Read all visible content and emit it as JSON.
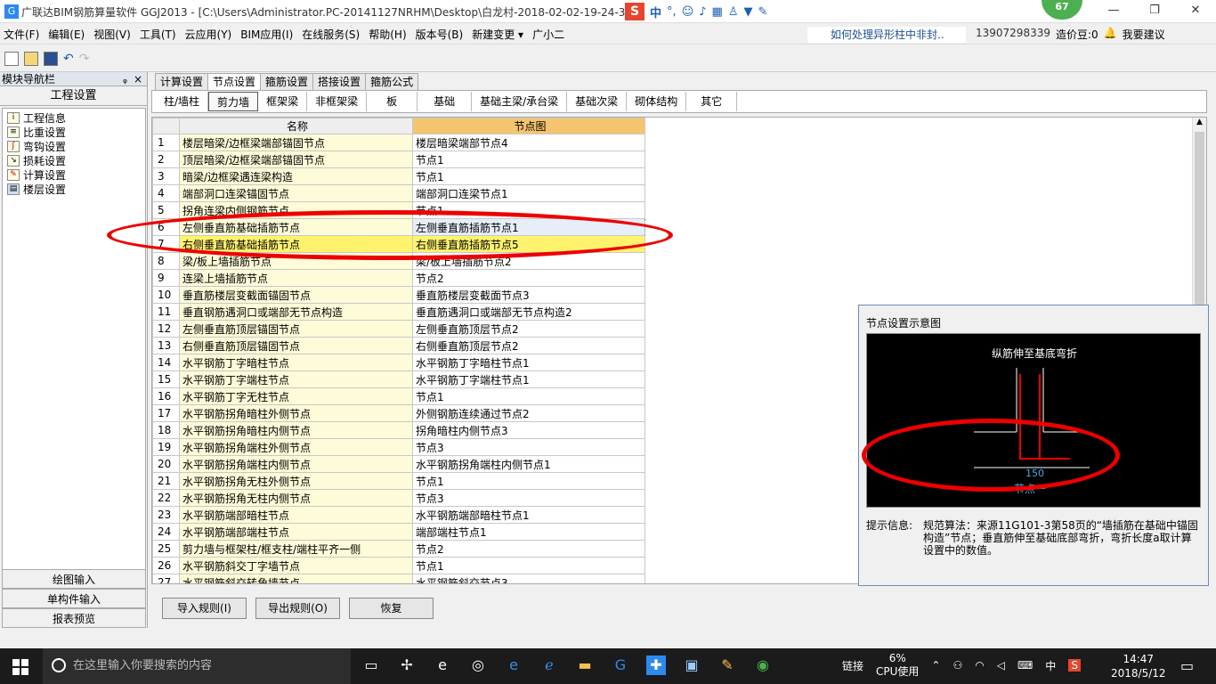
{
  "window": {
    "title": "广联达BIM钢筋算量软件 GGJ2013 - [C:\\Users\\Administrator.PC-20141127NRHM\\Desktop\\白龙村-2018-02-02-19-24-35",
    "app_icon": "G",
    "controls": [
      "—",
      "❐",
      "✕"
    ],
    "badge_score": "67"
  },
  "ime": {
    "logo": "S",
    "mode": "中",
    "punct": "°,",
    "icons": [
      "smile-icon",
      "mic-icon",
      "keyboard-icon",
      "user-icon",
      "shirt-icon",
      "wrench-icon"
    ]
  },
  "menu": {
    "items": [
      "文件(F)",
      "编辑(E)",
      "视图(V)",
      "工具(T)",
      "云应用(Y)",
      "BIM应用(I)",
      "在线服务(S)",
      "帮助(H)",
      "版本号(B)",
      "新建变更 ▾",
      "广小二"
    ],
    "ad_text": "如何处理异形柱中非封..",
    "phone": "13907298339",
    "beans": "造价豆:0",
    "suggest": "我要建议"
  },
  "left_panel": {
    "header": "模块导航栏",
    "pin": "ᵩ",
    "close": "×",
    "section": "工程设置",
    "tree": [
      {
        "label": "工程信息",
        "icon": "info"
      },
      {
        "label": "比重设置",
        "icon": "scale"
      },
      {
        "label": "弯钩设置",
        "icon": "hook"
      },
      {
        "label": "损耗设置",
        "icon": "loss"
      },
      {
        "label": "计算设置",
        "icon": "calc"
      },
      {
        "label": "楼层设置",
        "icon": "floor"
      }
    ],
    "bottom": [
      "绘图输入",
      "单构件输入",
      "报表预览"
    ]
  },
  "tabs_top": [
    "计算设置",
    "节点设置",
    "箍筋设置",
    "搭接设置",
    "箍筋公式"
  ],
  "tabs_top_active": 1,
  "tabs_sub": [
    "柱/墙柱",
    "剪力墙",
    "框架梁",
    "非框架梁",
    "板",
    "基础",
    "基础主梁/承台梁",
    "基础次梁",
    "砌体结构",
    "其它"
  ],
  "tabs_sub_active": 1,
  "table": {
    "headers": [
      "",
      "名称",
      "节点图"
    ],
    "rows": [
      [
        "1",
        "楼层暗梁/边框梁端部锚固节点",
        "楼层暗梁端部节点4"
      ],
      [
        "2",
        "顶层暗梁/边框梁端部锚固节点",
        "节点1"
      ],
      [
        "3",
        "暗梁/边框梁遇连梁构造",
        "节点1"
      ],
      [
        "4",
        "端部洞口连梁锚固节点",
        "端部洞口连梁节点1"
      ],
      [
        "5",
        "拐角连梁内侧钢筋节点",
        "节点1"
      ],
      [
        "6",
        "左侧垂直筋基础插筋节点",
        "左侧垂直筋插筋节点1"
      ],
      [
        "7",
        "右侧垂直筋基础插筋节点",
        "右侧垂直筋插筋节点5"
      ],
      [
        "8",
        "梁/板上墙插筋节点",
        "梁/板上墙插筋节点2"
      ],
      [
        "9",
        "连梁上墙插筋节点",
        "节点2"
      ],
      [
        "10",
        "垂直筋楼层变截面锚固节点",
        "垂直筋楼层变截面节点3"
      ],
      [
        "11",
        "垂直钢筋遇洞口或端部无节点构造",
        "垂直筋遇洞口或端部无节点构造2"
      ],
      [
        "12",
        "左侧垂直筋顶层锚固节点",
        "左侧垂直筋顶层节点2"
      ],
      [
        "13",
        "右侧垂直筋顶层锚固节点",
        "右侧垂直筋顶层节点2"
      ],
      [
        "14",
        "水平钢筋丁字暗柱节点",
        "水平钢筋丁字暗柱节点1"
      ],
      [
        "15",
        "水平钢筋丁字端柱节点",
        "水平钢筋丁字端柱节点1"
      ],
      [
        "16",
        "水平钢筋丁字无柱节点",
        "节点1"
      ],
      [
        "17",
        "水平钢筋拐角暗柱外侧节点",
        "外侧钢筋连续通过节点2"
      ],
      [
        "18",
        "水平钢筋拐角暗柱内侧节点",
        "拐角暗柱内侧节点3"
      ],
      [
        "19",
        "水平钢筋拐角端柱外侧节点",
        "节点3"
      ],
      [
        "20",
        "水平钢筋拐角端柱内侧节点",
        "水平钢筋拐角端柱内侧节点1"
      ],
      [
        "21",
        "水平钢筋拐角无柱外侧节点",
        "节点1"
      ],
      [
        "22",
        "水平钢筋拐角无柱内侧节点",
        "节点3"
      ],
      [
        "23",
        "水平钢筋端部暗柱节点",
        "水平钢筋端部暗柱节点1"
      ],
      [
        "24",
        "水平钢筋端部端柱节点",
        "端部端柱节点1"
      ],
      [
        "25",
        "剪力墙与框架柱/框支柱/端柱平齐一侧",
        "节点2"
      ],
      [
        "26",
        "水平钢筋斜交丁字墙节点",
        "节点1"
      ],
      [
        "27",
        "水平钢筋斜交转角墙节点",
        "水平钢筋斜交节点3"
      ]
    ],
    "selected_row": 6,
    "current_row": 5
  },
  "buttons": [
    "导入规则(I)",
    "导出规则(O)",
    "恢复"
  ],
  "diagram": {
    "title": "节点设置示意图",
    "caption": "纵筋伸至基底弯折",
    "dim": "150",
    "node_label": "节点一",
    "hint_label": "提示信息:",
    "hint_text": "规范算法：来源11G101-3第58页的“墙插筋在基础中锚固构造”节点；垂直筋伸至基础底部弯折，弯折长度a取计算设置中的数值。"
  },
  "taskbar": {
    "search_placeholder": "在这里输入你要搜索的内容",
    "tray_link": "链接",
    "cpu": "6%",
    "cpu_label": "CPU使用",
    "lang": "中",
    "time": "14:47",
    "date": "2018/5/12"
  },
  "colors": {
    "accent_red": "#e00000",
    "selected_row": "#fff36e",
    "name_col": "#fdfbd8",
    "header_node": "#f5c46e"
  }
}
